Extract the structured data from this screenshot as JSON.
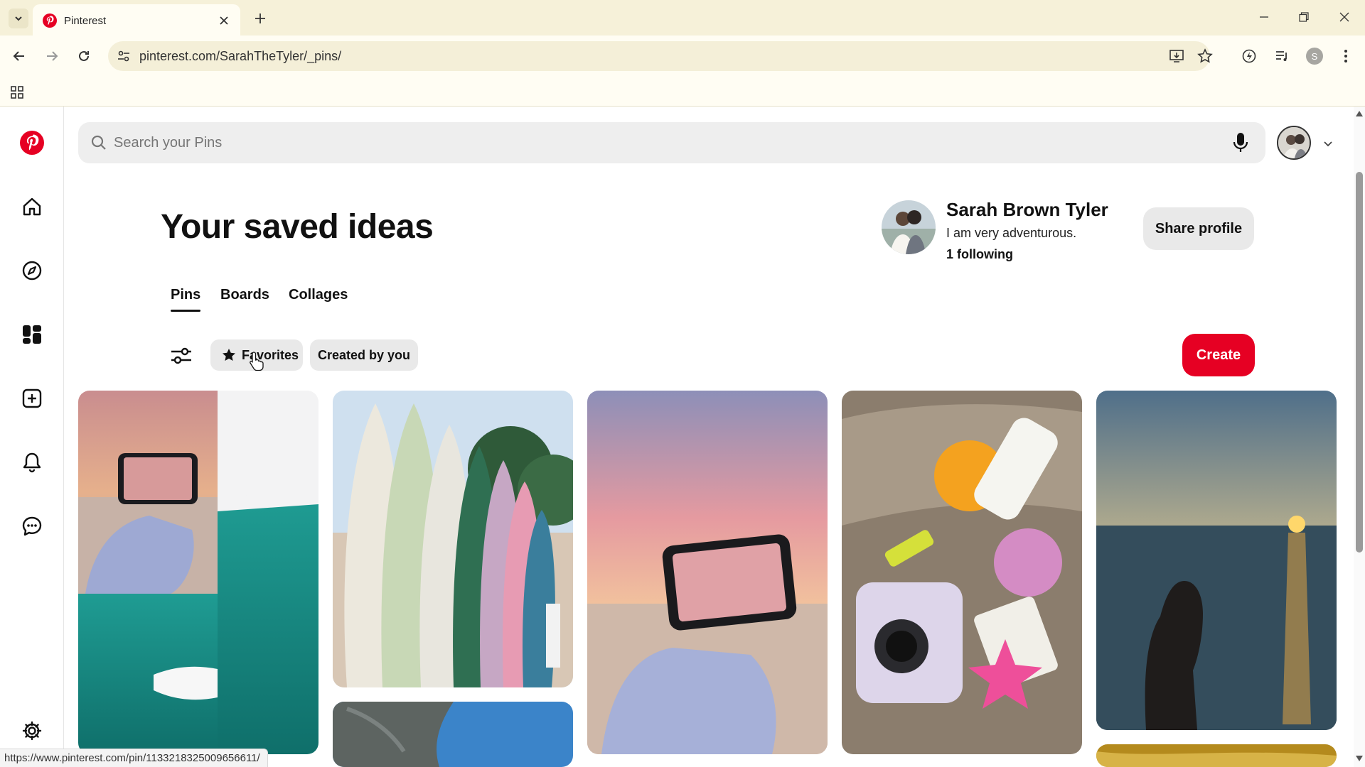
{
  "browser": {
    "tab_title": "Pinterest",
    "url": "pinterest.com/SarahTheTyler/_pins/",
    "profile_initial": "S",
    "status_url": "https://www.pinterest.com/pin/1133218325009656611/"
  },
  "search": {
    "placeholder": "Search your Pins",
    "value": ""
  },
  "page": {
    "title": "Your saved ideas"
  },
  "profile": {
    "name": "Sarah Brown Tyler",
    "bio": "I am very adventurous.",
    "following": "1 following",
    "share_label": "Share profile"
  },
  "tabs": {
    "pins": "Pins",
    "boards": "Boards",
    "collages": "Collages",
    "active": "Pins"
  },
  "filters": {
    "favorites": "Favorites",
    "created_by_you": "Created by you",
    "create_label": "Create"
  },
  "colors": {
    "brand": "#e60023",
    "chip_bg": "#e9e9e9",
    "chrome_bg": "#f6f1d9"
  },
  "icons": {
    "sidebar": [
      "pinterest-logo-icon",
      "home-icon",
      "explore-icon",
      "boards-icon",
      "create-icon",
      "notifications-icon",
      "messages-icon",
      "settings-icon"
    ]
  },
  "pins": [
    {
      "name": "pin-phone-sunset-ocean-collage"
    },
    {
      "name": "pin-surfboards"
    },
    {
      "name": "pin-phone-sunset-beach"
    },
    {
      "name": "pin-beach-essentials"
    },
    {
      "name": "pin-ocean-sunset-silhouette"
    },
    {
      "name": "pin-cliff-blue-sky"
    },
    {
      "name": "pin-golden-partial"
    }
  ]
}
